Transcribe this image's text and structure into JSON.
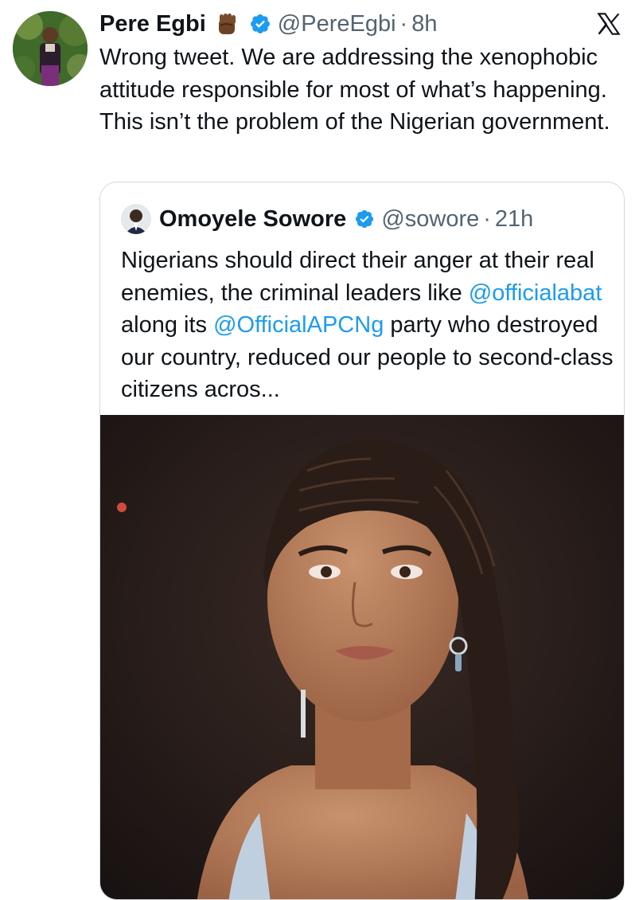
{
  "tweet": {
    "author_name": "Pere Egbi",
    "author_handle": "@PereEgbi",
    "dot": "·",
    "time": "8h",
    "text": "Wrong tweet. We are addressing the xenophobic attitude responsible for most of what’s happening. This isn’t the problem of the Nigerian government.",
    "emoji_icon": "raised-fist-medium-dark-skin",
    "verified_icon": "verified-badge",
    "platform_icon": "x-logo"
  },
  "quoted": {
    "author_name": "Omoyele Sowore",
    "author_handle": "@sowore",
    "dot": "·",
    "time": "21h",
    "text_1": "Nigerians should direct their anger at their real enemies, the criminal leaders like ",
    "mention_1": "@officialabat",
    "text_2": " along its ",
    "mention_2": "@OfficialAPCNg",
    "text_3": " party who destroyed our country, reduced our people to second-class citizens acros...",
    "media": "photo"
  },
  "colors": {
    "text": "#0f1419",
    "secondary": "#536471",
    "link": "#1d9bf0",
    "verified": "#1d9bf0",
    "border": "#cfd9de"
  }
}
